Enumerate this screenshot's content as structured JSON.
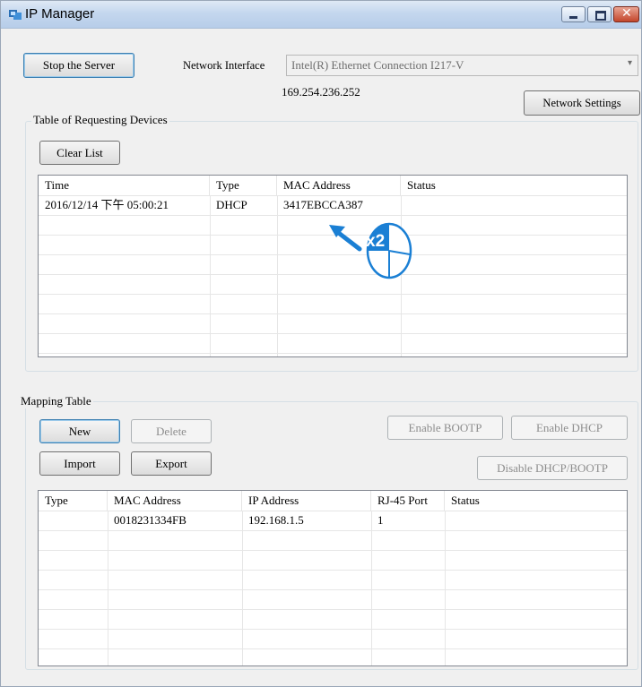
{
  "window": {
    "title": "IP Manager"
  },
  "server": {
    "stop_button": "Stop the Server",
    "network_interface_label": "Network Interface",
    "network_interface_value": "Intel(R) Ethernet Connection I217-V",
    "ip_address": "169.254.236.252",
    "network_settings_button": "Network Settings"
  },
  "requesting": {
    "group_title": "Table of Requesting Devices",
    "clear_button": "Clear List",
    "columns": [
      "Time",
      "Type",
      "MAC Address",
      "Status"
    ],
    "rows": [
      [
        "2016/12/14 下午 05:00:21",
        "DHCP",
        "3417EBCCA387",
        ""
      ]
    ]
  },
  "annotation": {
    "double_click_label": "x2",
    "accent_color": "#1a7fd4"
  },
  "mapping": {
    "group_title": "Mapping Table",
    "new_button": "New",
    "delete_button": "Delete",
    "import_button": "Import",
    "export_button": "Export",
    "enable_bootp_button": "Enable BOOTP",
    "enable_dhcp_button": "Enable DHCP",
    "disable_button": "Disable DHCP/BOOTP",
    "columns": [
      "Type",
      "MAC Address",
      "IP Address",
      "RJ-45 Port",
      "Status"
    ],
    "rows": [
      [
        "",
        "0018231334FB",
        "192.168.1.5",
        "1",
        ""
      ]
    ]
  }
}
